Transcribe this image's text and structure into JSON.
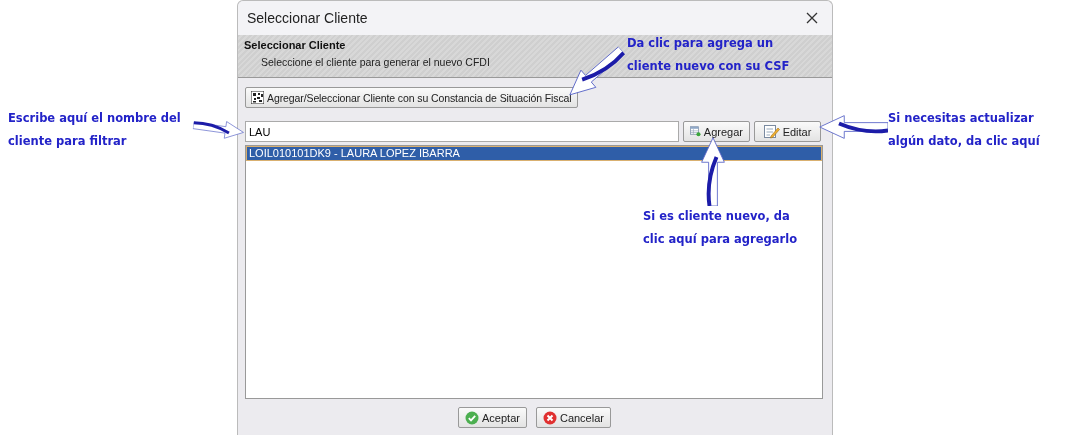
{
  "window": {
    "title": "Seleccionar Cliente"
  },
  "header": {
    "title": "Seleccionar Cliente",
    "subtitle": "Seleccione el cliente para generar el nuevo CFDI"
  },
  "csf_button": {
    "label": "Agregar/Seleccionar Cliente con su Constancia de Situación Fiscal"
  },
  "search": {
    "value": "LAU"
  },
  "buttons": [
    {
      "label": "Agregar",
      "kind": "add"
    },
    {
      "label": "Editar",
      "kind": "edit"
    }
  ],
  "clients": [
    {
      "label": "LOIL010101DK9 - LAURA LOPEZ IBARRA",
      "selected": true
    }
  ],
  "footer_buttons": [
    {
      "label": "Aceptar",
      "kind": "ok"
    },
    {
      "label": "Cancelar",
      "kind": "cancel"
    }
  ],
  "annotations": [
    {
      "kind": "csf",
      "lines": [
        "Da clic para agrega un",
        "cliente nuevo con su CSF"
      ]
    },
    {
      "kind": "filter",
      "lines": [
        "Escribe aquí el nombre del",
        "cliente para filtrar"
      ]
    },
    {
      "kind": "edit",
      "lines": [
        "Si necesitas actualizar",
        "algún dato, da clic aquí"
      ]
    },
    {
      "kind": "add",
      "lines": [
        "Si es cliente nuevo, da",
        "clic aquí para agregarlo"
      ]
    }
  ]
}
